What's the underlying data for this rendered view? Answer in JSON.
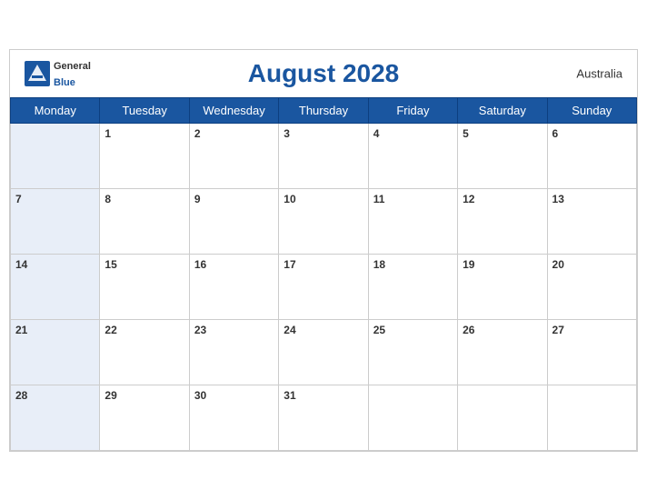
{
  "header": {
    "title": "August 2028",
    "country": "Australia",
    "logo": {
      "general": "General",
      "blue": "Blue"
    }
  },
  "weekdays": [
    "Monday",
    "Tuesday",
    "Wednesday",
    "Thursday",
    "Friday",
    "Saturday",
    "Sunday"
  ],
  "weeks": [
    [
      null,
      1,
      2,
      3,
      4,
      5,
      6
    ],
    [
      7,
      8,
      9,
      10,
      11,
      12,
      13
    ],
    [
      14,
      15,
      16,
      17,
      18,
      19,
      20
    ],
    [
      21,
      22,
      23,
      24,
      25,
      26,
      27
    ],
    [
      28,
      29,
      30,
      31,
      null,
      null,
      null
    ]
  ]
}
